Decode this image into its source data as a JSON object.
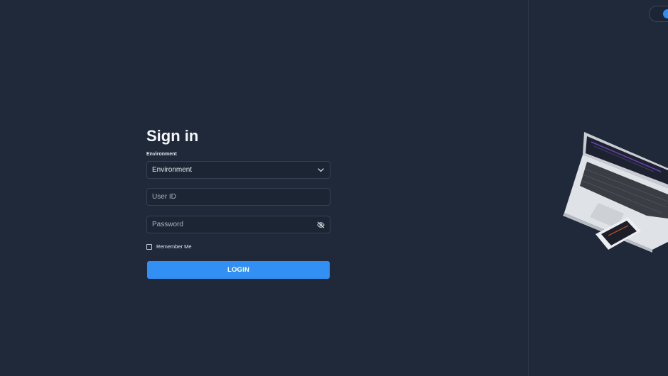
{
  "page": {
    "title": "Sign in"
  },
  "form": {
    "environment_label": "Environment",
    "environment_value": "Environment",
    "user_id_placeholder": "User ID",
    "password_placeholder": "Password",
    "remember_label": "Remember Me",
    "remember_checked": false,
    "login_label": "LOGIN"
  },
  "icons": {
    "dropdown": "chevron-down-icon",
    "password_visibility": "eye-off-icon",
    "toggle": "theme-toggle"
  },
  "colors": {
    "background": "#1f293a",
    "accent": "#3290f5",
    "field_border": "#344154"
  }
}
